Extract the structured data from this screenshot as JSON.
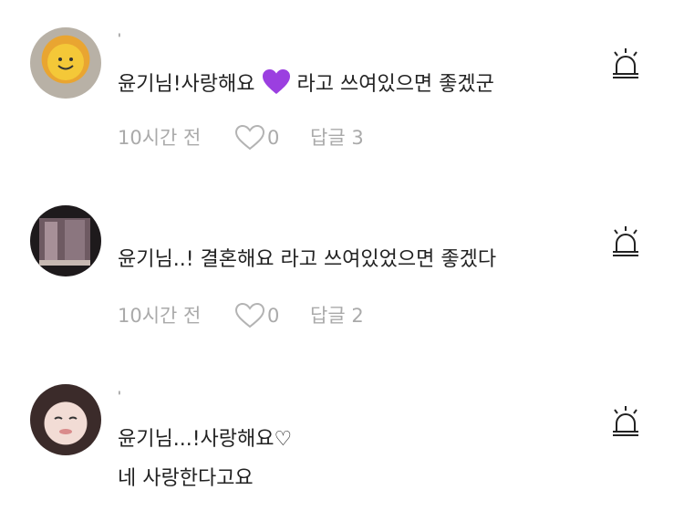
{
  "comments": [
    {
      "author": "'",
      "text_before": "윤기님!사랑해요",
      "text_after": "라고 쓰여있으면 좋겠군",
      "emoji": "purple-heart",
      "time": "10시간 전",
      "likes": "0",
      "reply": "답글 3"
    },
    {
      "author": "",
      "text_before": "윤기님..! 결혼해요 라고 쓰여있었으면 좋겠다",
      "time": "10시간 전",
      "likes": "0",
      "reply": "답글 2"
    },
    {
      "author": "'",
      "text_before": "윤기님...!사랑해요♡",
      "text_line2": "네 사랑한다고요"
    }
  ],
  "icons": {
    "report": "siren-icon",
    "like": "heart-outline-icon"
  }
}
